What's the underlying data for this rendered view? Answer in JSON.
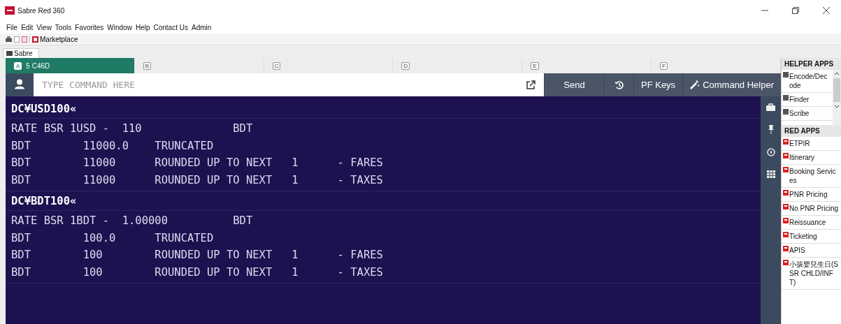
{
  "window": {
    "title": "Sabre Red 360"
  },
  "menu": [
    "File",
    "Edit",
    "View",
    "Tools",
    "Favorites",
    "Window",
    "Help",
    "Contact Us",
    "Admin"
  ],
  "toolbar": {
    "marketplace": "Marketplace"
  },
  "perspective_tab": {
    "label": "Sabre"
  },
  "workspace_tabs": [
    {
      "letter": "A",
      "label": "5 C46D",
      "selected": true
    },
    {
      "letter": "B",
      "selected": false
    },
    {
      "letter": "C",
      "selected": false
    },
    {
      "letter": "D",
      "selected": false
    },
    {
      "letter": "E",
      "selected": false
    },
    {
      "letter": "F",
      "selected": false
    }
  ],
  "command_bar": {
    "placeholder": "TYPE COMMAND HERE",
    "send": "Send",
    "pf_keys": "PF Keys",
    "command_helper": "Command Helper"
  },
  "terminal": [
    {
      "command": "DC¥USD100«",
      "lines": [
        "RATE BSR 1USD -  110              BDT",
        "BDT        11000.0    TRUNCATED",
        "BDT        11000      ROUNDED UP TO NEXT   1      - FARES",
        "BDT        11000      ROUNDED UP TO NEXT   1      - TAXES"
      ]
    },
    {
      "command": "DC¥BDT100«",
      "lines": [
        "RATE BSR 1BDT -  1.00000          BDT",
        "BDT        100.0      TRUNCATED",
        "BDT        100        ROUNDED UP TO NEXT   1      - FARES",
        "BDT        100        ROUNDED UP TO NEXT   1      - TAXES"
      ]
    }
  ],
  "helper_apps": {
    "title": "HELPER APPS",
    "items": [
      "Encode/Decode",
      "Finder",
      "Scribe"
    ]
  },
  "red_apps": {
    "title": "RED APPS",
    "items": [
      "ETPIR",
      "Itinerary",
      "Booking Services",
      "PNR Pricing",
      "No PNR Pricing",
      "Reissuance",
      "Ticketing",
      "APIS",
      "小孩嬰兒生日(SSR CHLD/INFT)"
    ]
  }
}
